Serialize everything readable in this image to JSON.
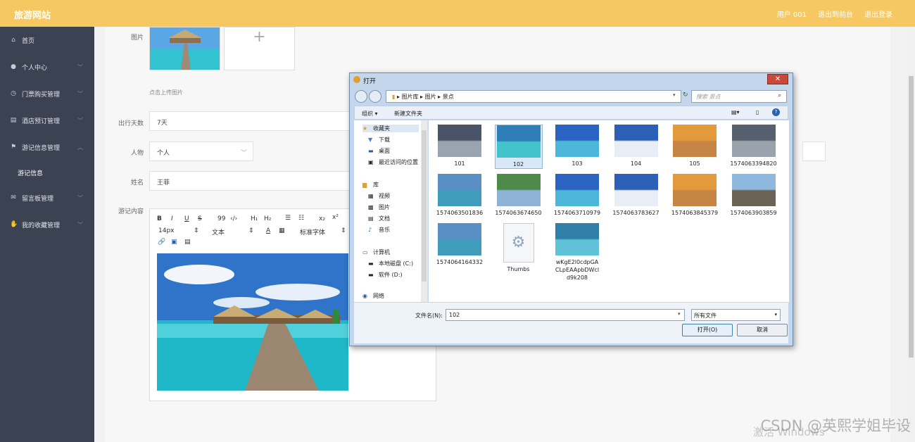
{
  "topbar": {
    "brand": "旅游网站",
    "user": "用户 001",
    "back": "退出到前台",
    "logout": "退出登录"
  },
  "sidebar": {
    "items": [
      {
        "label": "首页",
        "icon": "home-icon",
        "glyph": "⌂"
      },
      {
        "label": "个人中心",
        "icon": "user-icon",
        "glyph": "●"
      },
      {
        "label": "门票购买管理",
        "icon": "clock-icon",
        "glyph": "◷"
      },
      {
        "label": "酒店预订管理",
        "icon": "clipboard-icon",
        "glyph": "▤"
      },
      {
        "label": "游记信息管理",
        "icon": "flag-icon",
        "glyph": "⚑"
      }
    ],
    "sub": "游记信息",
    "items2": [
      {
        "label": "留言板管理",
        "icon": "mail-icon",
        "glyph": "✉"
      },
      {
        "label": "我的收藏管理",
        "icon": "thumb-icon",
        "glyph": "✋"
      }
    ]
  },
  "form": {
    "image_label": "图片",
    "upload_hint": "点击上传图片",
    "days_label": "出行天数",
    "days_value": "7天",
    "person_label": "人物",
    "person_value": "个人",
    "name_label": "姓名",
    "name_value": "王菲",
    "content_label": "游记内容",
    "toolbar": {
      "b": "B",
      "i": "I",
      "u": "U",
      "s": "S",
      "quote": "99",
      "code": "‹/›",
      "h1": "H₁",
      "h2": "H₂",
      "sub": "x₂",
      "sup": "x²",
      "size": "14px",
      "type": "文本",
      "font": "标准字体"
    }
  },
  "dialog": {
    "title": "打开",
    "path": [
      "图片库",
      "图片",
      "景点"
    ],
    "search": "搜索 景点",
    "organize": "组织 ▾",
    "newfolder": "新建文件夹",
    "tree": {
      "fav": "收藏夹",
      "download": "下载",
      "desktop": "桌面",
      "recent": "最近访问的位置",
      "lib": "库",
      "video": "视频",
      "pics": "图片",
      "docs": "文档",
      "music": "音乐",
      "computer": "计算机",
      "diskc": "本地磁盘 (C:)",
      "diskd": "软件 (D:)",
      "net": "网络"
    },
    "files": [
      "101",
      "102",
      "103",
      "104",
      "105",
      "1574063394820",
      "1574063501836",
      "1574063674650",
      "1574063710979",
      "1574063783627",
      "1574063845379",
      "1574063903859",
      "1574064164332",
      "Thumbs",
      "wKgE2l0cdpGACLpEAApbDWcld9k208"
    ],
    "filename_label": "文件名(N):",
    "filename_value": "102",
    "filter": "所有文件",
    "open": "打开(O)",
    "cancel": "取消"
  },
  "watermark": "CSDN @英熙学姐毕设",
  "activate": "激活 Windows",
  "colors": {
    "topbar": "#f5c861",
    "sidebar": "#3b4352"
  }
}
